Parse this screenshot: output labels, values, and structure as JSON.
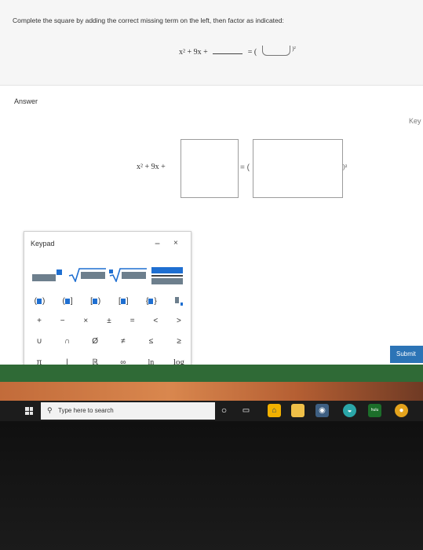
{
  "question": {
    "prompt": "Complete the square by adding the correct missing term on the left, then factor as indicated:",
    "expr_left": "x² + 9x +",
    "expr_equals": "= (",
    "expr_close": ")²"
  },
  "answer": {
    "label": "Answer",
    "key_link": "Key",
    "eq_left": "x² + 9x +",
    "eq_mid": "= (",
    "eq_end": ")²"
  },
  "keypad": {
    "title": "Keypad",
    "minimize": "−",
    "close": "×",
    "row2": [
      "(■)",
      "(■]",
      "[■)",
      "[■]",
      "{■}",
      "■"
    ],
    "row3": [
      "+",
      "−",
      "×",
      "±",
      "=",
      "<",
      ">"
    ],
    "row4": [
      "∪",
      "∩",
      "Ø",
      "≠",
      "≤",
      "≥"
    ],
    "row5": [
      "π",
      "|",
      "ℝ",
      "∞",
      "ln",
      "log"
    ]
  },
  "submit": {
    "label": "Submit"
  },
  "taskbar": {
    "search_placeholder": "Type here to search",
    "icons": [
      "cortana-icon",
      "task-view-icon",
      "edge-icon",
      "file-explorer-icon",
      "camera-icon",
      "photos-icon",
      "hulu-icon",
      "chrome-icon"
    ]
  }
}
